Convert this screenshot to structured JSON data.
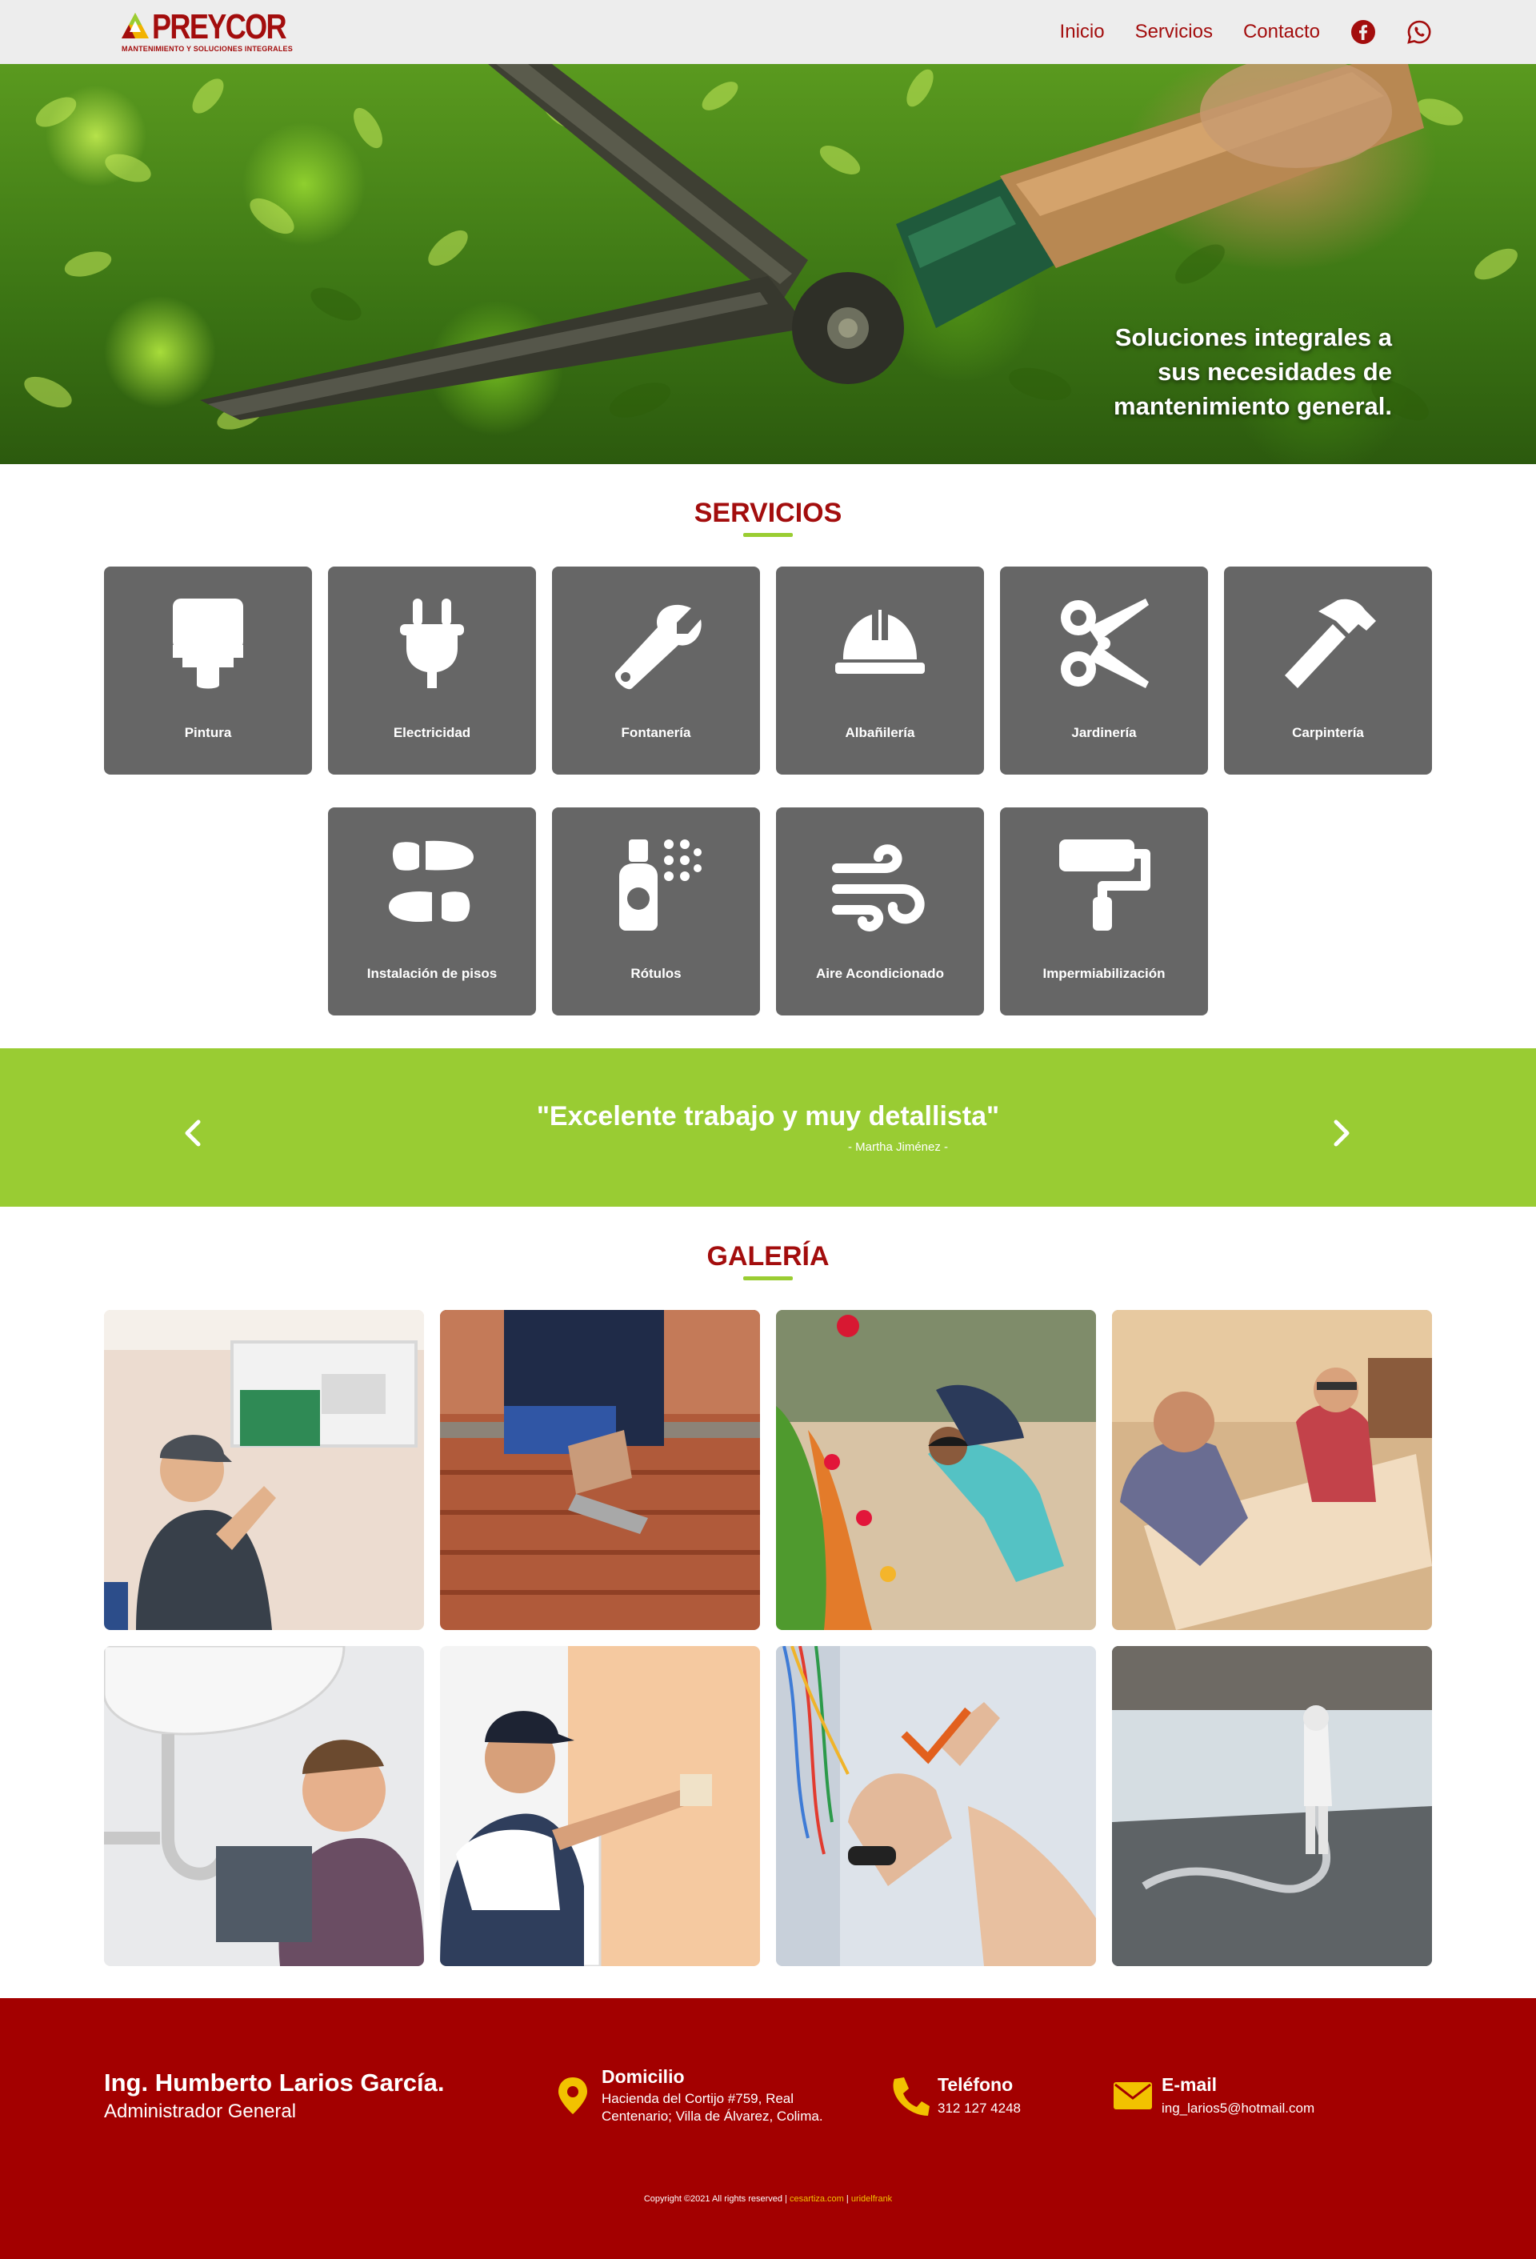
{
  "brand": {
    "name": "PREYCOR",
    "tagline": "MANTENIMIENTO Y SOLUCIONES INTEGRALES",
    "color": "#a30d0d",
    "accent": "#9acd32"
  },
  "nav": {
    "links": [
      "Inicio",
      "Servicios",
      "Contacto"
    ],
    "icons": [
      "facebook-icon",
      "whatsapp-icon"
    ]
  },
  "hero": {
    "caption": "Soluciones integrales a sus necesidades de mantenimiento general."
  },
  "services": {
    "title": "SERVICIOS",
    "items": [
      {
        "label": "Pintura",
        "icon": "paint-brush-icon"
      },
      {
        "label": "Electricidad",
        "icon": "plug-icon"
      },
      {
        "label": "Fontanería",
        "icon": "wrench-icon"
      },
      {
        "label": "Albañilería",
        "icon": "hard-hat-icon"
      },
      {
        "label": "Jardinería",
        "icon": "scissors-icon"
      },
      {
        "label": "Carpintería",
        "icon": "hammer-icon"
      },
      {
        "label": "Instalación de pisos",
        "icon": "shoe-prints-icon"
      },
      {
        "label": "Rótulos",
        "icon": "spray-can-icon"
      },
      {
        "label": "Aire Acondicionado",
        "icon": "wind-icon"
      },
      {
        "label": "Impermiabilización",
        "icon": "paint-roller-icon"
      }
    ]
  },
  "testimonial": {
    "quote": "\"Excelente trabajo y muy detallista\"",
    "author": "- Martha Jiménez -"
  },
  "gallery": {
    "title": "GALERÍA",
    "images": [
      "air-conditioner-technician-photo",
      "bricklayer-photo",
      "gardeners-photo",
      "carpenters-photo",
      "plumber-photo",
      "painter-photo",
      "electrician-photo",
      "waterproofing-roof-photo"
    ]
  },
  "footer": {
    "name": "Ing. Humberto Larios García.",
    "role": "Administrador General",
    "address": {
      "title": "Domicilio",
      "line1": "Hacienda del Cortijo #759, Real",
      "line2": "Centenario; Villa de Álvarez, Colima."
    },
    "phone": {
      "title": "Teléfono",
      "value": "312 127 4248"
    },
    "email": {
      "title": "E-mail",
      "value": "ing_larios5@hotmail.com"
    },
    "copyright": "Copyright ©2021 All rights reserved |",
    "credit1": "cesartiza.com",
    "separator": "|",
    "credit2": "uridelfrank"
  }
}
